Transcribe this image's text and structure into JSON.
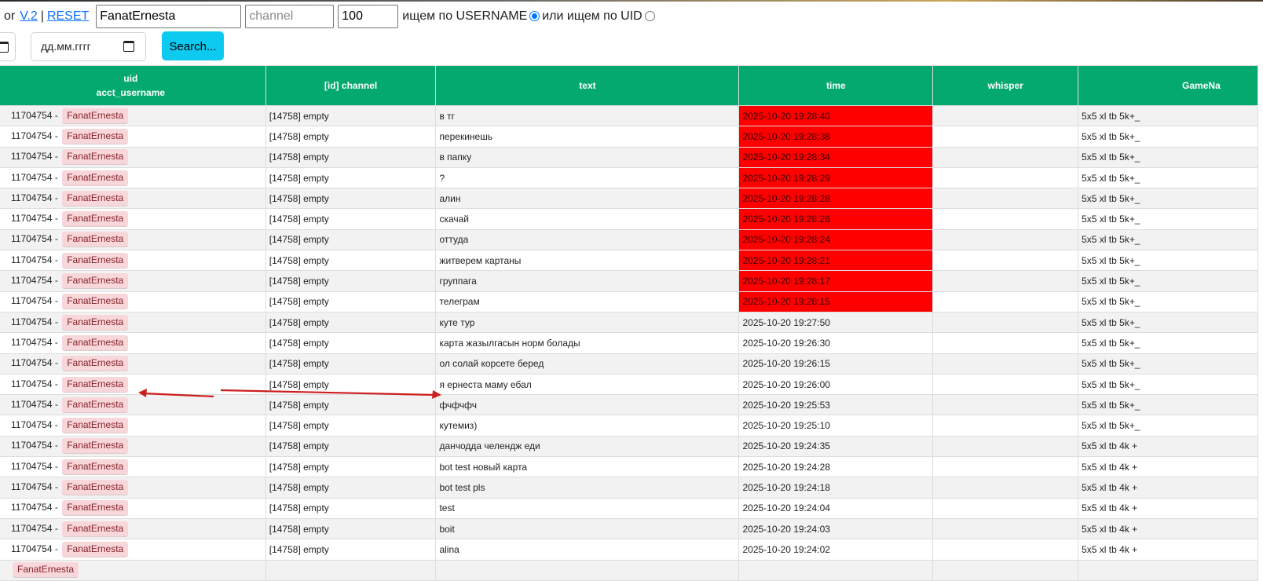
{
  "header": {
    "or_text": "or",
    "v2_link": "V.2",
    "separator": "|",
    "reset_link": "RESET",
    "username_value": "FanatErnesta",
    "channel_placeholder": "channel",
    "limit_value": "100",
    "search_by_username_label": "ищем по USERNAME",
    "search_by_uid_label": "или ищем по UID",
    "selected_mode": "username"
  },
  "filters": {
    "date_placeholder": "дд.мм.гггг",
    "search_button": "Search..."
  },
  "table": {
    "columns": {
      "uid": "uid",
      "acct_username": "acct_username",
      "channel": "[id] channel",
      "text": "text",
      "time": "time",
      "whisper": "whisper",
      "gamename": "GameNa"
    },
    "rows": [
      {
        "uid": "11704754 -",
        "username": "FanatErnesta",
        "channel": "[14758] empty",
        "text": "в тг",
        "time": "2025-10-20 19:28:40",
        "whisper": "",
        "game": "5x5 xl tb 5k+_",
        "highlight": true
      },
      {
        "uid": "11704754 -",
        "username": "FanatErnesta",
        "channel": "[14758] empty",
        "text": "перекинешь",
        "time": "2025-10-20 19:28:38",
        "whisper": "",
        "game": "5x5 xl tb 5k+_",
        "highlight": true
      },
      {
        "uid": "11704754 -",
        "username": "FanatErnesta",
        "channel": "[14758] empty",
        "text": "в папку",
        "time": "2025-10-20 19:28:34",
        "whisper": "",
        "game": "5x5 xl tb 5k+_",
        "highlight": true
      },
      {
        "uid": "11704754 -",
        "username": "FanatErnesta",
        "channel": "[14758] empty",
        "text": "?",
        "time": "2025-10-20 19:28:29",
        "whisper": "",
        "game": "5x5 xl tb 5k+_",
        "highlight": true
      },
      {
        "uid": "11704754 -",
        "username": "FanatErnesta",
        "channel": "[14758] empty",
        "text": "алин",
        "time": "2025-10-20 19:28:28",
        "whisper": "",
        "game": "5x5 xl tb 5k+_",
        "highlight": true
      },
      {
        "uid": "11704754 -",
        "username": "FanatErnesta",
        "channel": "[14758] empty",
        "text": "скачай",
        "time": "2025-10-20 19:28:26",
        "whisper": "",
        "game": "5x5 xl tb 5k+_",
        "highlight": true
      },
      {
        "uid": "11704754 -",
        "username": "FanatErnesta",
        "channel": "[14758] empty",
        "text": "оттуда",
        "time": "2025-10-20 19:28:24",
        "whisper": "",
        "game": "5x5 xl tb 5k+_",
        "highlight": true
      },
      {
        "uid": "11704754 -",
        "username": "FanatErnesta",
        "channel": "[14758] empty",
        "text": "житверем картаны",
        "time": "2025-10-20 19:28:21",
        "whisper": "",
        "game": "5x5 xl tb 5k+_",
        "highlight": true
      },
      {
        "uid": "11704754 -",
        "username": "FanatErnesta",
        "channel": "[14758] empty",
        "text": "группага",
        "time": "2025-10-20 19:28:17",
        "whisper": "",
        "game": "5x5 xl tb 5k+_",
        "highlight": true
      },
      {
        "uid": "11704754 -",
        "username": "FanatErnesta",
        "channel": "[14758] empty",
        "text": "телеграм",
        "time": "2025-10-20 19:28:15",
        "whisper": "",
        "game": "5x5 xl tb 5k+_",
        "highlight": true
      },
      {
        "uid": "11704754 -",
        "username": "FanatErnesta",
        "channel": "[14758] empty",
        "text": "куте тур",
        "time": "2025-10-20 19:27:50",
        "whisper": "",
        "game": "5x5 xl tb 5k+_",
        "highlight": false
      },
      {
        "uid": "11704754 -",
        "username": "FanatErnesta",
        "channel": "[14758] empty",
        "text": "карта жазылгасын норм болады",
        "time": "2025-10-20 19:26:30",
        "whisper": "",
        "game": "5x5 xl tb 5k+_",
        "highlight": false
      },
      {
        "uid": "11704754 -",
        "username": "FanatErnesta",
        "channel": "[14758] empty",
        "text": "ол солай корсете беред",
        "time": "2025-10-20 19:26:15",
        "whisper": "",
        "game": "5x5 xl tb 5k+_",
        "highlight": false
      },
      {
        "uid": "11704754 -",
        "username": "FanatErnesta",
        "channel": "[14758] empty",
        "text": "я ернеста маму ебал",
        "time": "2025-10-20 19:26:00",
        "whisper": "",
        "game": "5x5 xl tb 5k+_",
        "highlight": false
      },
      {
        "uid": "11704754 -",
        "username": "FanatErnesta",
        "channel": "[14758] empty",
        "text": "фчфчфч",
        "time": "2025-10-20 19:25:53",
        "whisper": "",
        "game": "5x5 xl tb 5k+_",
        "highlight": false
      },
      {
        "uid": "11704754 -",
        "username": "FanatErnesta",
        "channel": "[14758] empty",
        "text": "кутемиз)",
        "time": "2025-10-20 19:25:10",
        "whisper": "",
        "game": "5x5 xl tb 5k+_",
        "highlight": false
      },
      {
        "uid": "11704754 -",
        "username": "FanatErnesta",
        "channel": "[14758] empty",
        "text": "данчодда челендж еди",
        "time": "2025-10-20 19:24:35",
        "whisper": "",
        "game": "5x5 xl tb 4k +",
        "highlight": false
      },
      {
        "uid": "11704754 -",
        "username": "FanatErnesta",
        "channel": "[14758] empty",
        "text": "bot test новый карта",
        "time": "2025-10-20 19:24:28",
        "whisper": "",
        "game": "5x5 xl tb 4k +",
        "highlight": false
      },
      {
        "uid": "11704754 -",
        "username": "FanatErnesta",
        "channel": "[14758] empty",
        "text": "bot test pls",
        "time": "2025-10-20 19:24:18",
        "whisper": "",
        "game": "5x5 xl tb 4k +",
        "highlight": false
      },
      {
        "uid": "11704754 -",
        "username": "FanatErnesta",
        "channel": "[14758] empty",
        "text": "test",
        "time": "2025-10-20 19:24:04",
        "whisper": "",
        "game": "5x5 xl tb 4k +",
        "highlight": false
      },
      {
        "uid": "11704754 -",
        "username": "FanatErnesta",
        "channel": "[14758] empty",
        "text": "boit",
        "time": "2025-10-20 19:24:03",
        "whisper": "",
        "game": "5x5 xl tb 4k +",
        "highlight": false
      },
      {
        "uid": "11704754 -",
        "username": "FanatErnesta",
        "channel": "[14758] empty",
        "text": "alina",
        "time": "2025-10-20 19:24:02",
        "whisper": "",
        "game": "5x5 xl tb 4k +",
        "highlight": false
      },
      {
        "uid": "",
        "username": "FanatErnesta",
        "channel": "",
        "text": "",
        "time": "",
        "whisper": "",
        "game": "",
        "highlight": false
      }
    ]
  },
  "colors": {
    "header_green": "#04aa6d",
    "highlight_red": "#ff0000",
    "annotation_red": "#cc1f1f",
    "username_badge": "#f8d7da"
  }
}
